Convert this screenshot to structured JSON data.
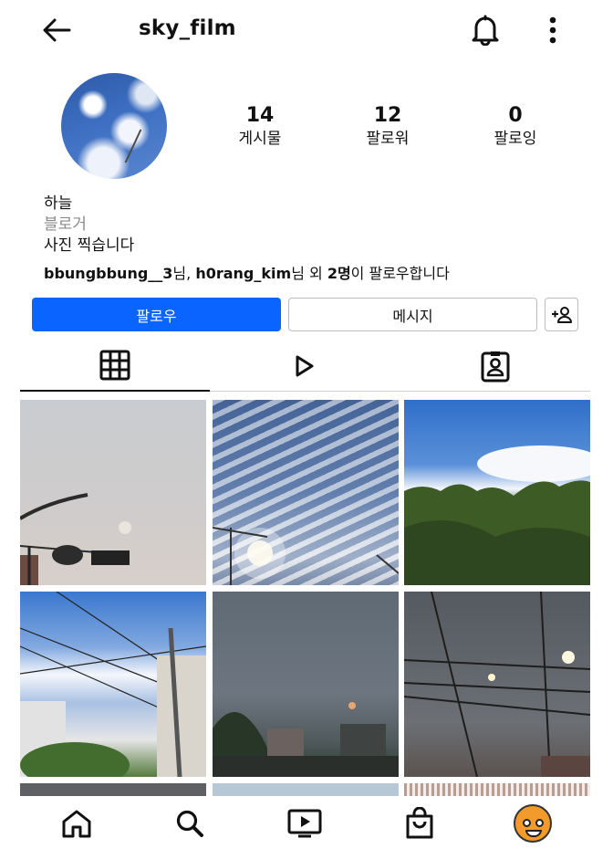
{
  "header": {
    "username": "sky_film"
  },
  "profile": {
    "stats": [
      {
        "value": "14",
        "label": "게시물"
      },
      {
        "value": "12",
        "label": "팔로워"
      },
      {
        "value": "0",
        "label": "팔로잉"
      }
    ],
    "bio": {
      "name": "하늘",
      "category": "블로거",
      "text": "사진 찍습니다"
    },
    "followed_by": {
      "user1": "bbungbbung__3",
      "sep1": "님, ",
      "user2": "h0rang_kim",
      "mid": "님 외 ",
      "count": "2명",
      "suffix": "이 팔로우합니다"
    },
    "buttons": {
      "follow": "팔로우",
      "message": "메시지"
    }
  },
  "tabs": [
    "grid-icon",
    "reels-icon",
    "tagged-icon"
  ],
  "bottom_nav": [
    "home-icon",
    "search-icon",
    "reels-tv-icon",
    "shop-icon",
    "profile-avatar"
  ],
  "colors": {
    "accent": "#0a64ff",
    "text": "#111111",
    "muted": "#8a8a8a"
  }
}
